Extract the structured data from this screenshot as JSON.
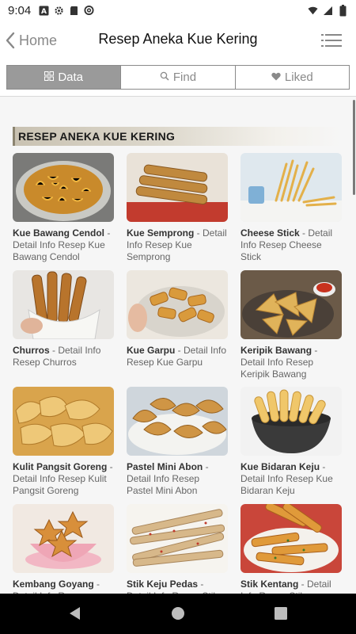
{
  "status_bar": {
    "time": "9:04",
    "left_icons": [
      "a-box-icon",
      "gear-icon",
      "sd-card-icon",
      "at-sign-icon"
    ],
    "right_icons": [
      "wifi-icon",
      "signal-icon",
      "battery-icon"
    ]
  },
  "header": {
    "back_label": "Home",
    "title": "Resep Aneka Kue Kering",
    "menu_icon": "hamburger-menu-icon"
  },
  "tabs": [
    {
      "label": "Data",
      "icon": "grid-icon",
      "active": true
    },
    {
      "label": "Find",
      "icon": "search-icon",
      "active": false
    },
    {
      "label": "Liked",
      "icon": "heart-icon",
      "active": false
    }
  ],
  "section": {
    "title": "RESEP ANEKA KUE KERING"
  },
  "items": [
    {
      "name": "Kue Bawang Cendol",
      "desc": " - Detail Info Resep Kue Bawang Cendol",
      "thumb_color": "#c98a2b"
    },
    {
      "name": "Kue Semprong",
      "desc": " - Detail Info Resep Kue Semprong",
      "thumb_color": "#c0893e"
    },
    {
      "name": "Cheese Stick",
      "desc": " - Detail Info Resep Cheese Stick",
      "thumb_color": "#e3b04a"
    },
    {
      "name": "Churros",
      "desc": " - Detail Info Resep Churros",
      "thumb_color": "#b8742c"
    },
    {
      "name": "Kue Garpu",
      "desc": " - Detail Info Resep Kue Garpu",
      "thumb_color": "#d99a3c"
    },
    {
      "name": "Keripik Bawang",
      "desc": " - Detail Info Resep Keripik Bawang",
      "thumb_color": "#e0b35a"
    },
    {
      "name": "Kulit Pangsit Goreng",
      "desc": " - Detail Info Resep Kulit Pangsit Goreng",
      "thumb_color": "#e8c06a"
    },
    {
      "name": "Pastel Mini Abon",
      "desc": " - Detail Info Resep Pastel Mini Abon",
      "thumb_color": "#cf9545"
    },
    {
      "name": "Kue Bidaran Keju",
      "desc": " - Detail Info Resep Kue Bidaran Keju",
      "thumb_color": "#f0c76a"
    },
    {
      "name": "Kembang Goyang",
      "desc": " - Detail Info Resep Kembang Goyang",
      "thumb_color": "#d88f3a"
    },
    {
      "name": "Stik Keju Pedas",
      "desc": " - Detail Info Resep Stik Keju Pedas",
      "thumb_color": "#d7b88a"
    },
    {
      "name": "Stik Kentang",
      "desc": " - Detail Info Resep Stik Kentang",
      "thumb_color": "#e09a3a"
    }
  ],
  "nav_bar": {
    "icons": [
      "back-triangle-icon",
      "home-circle-icon",
      "recents-square-icon"
    ]
  },
  "colors": {
    "tab_active_bg": "#9a9a9a",
    "tab_border": "#8a8a8a",
    "nav_bar_bg": "#000000"
  }
}
